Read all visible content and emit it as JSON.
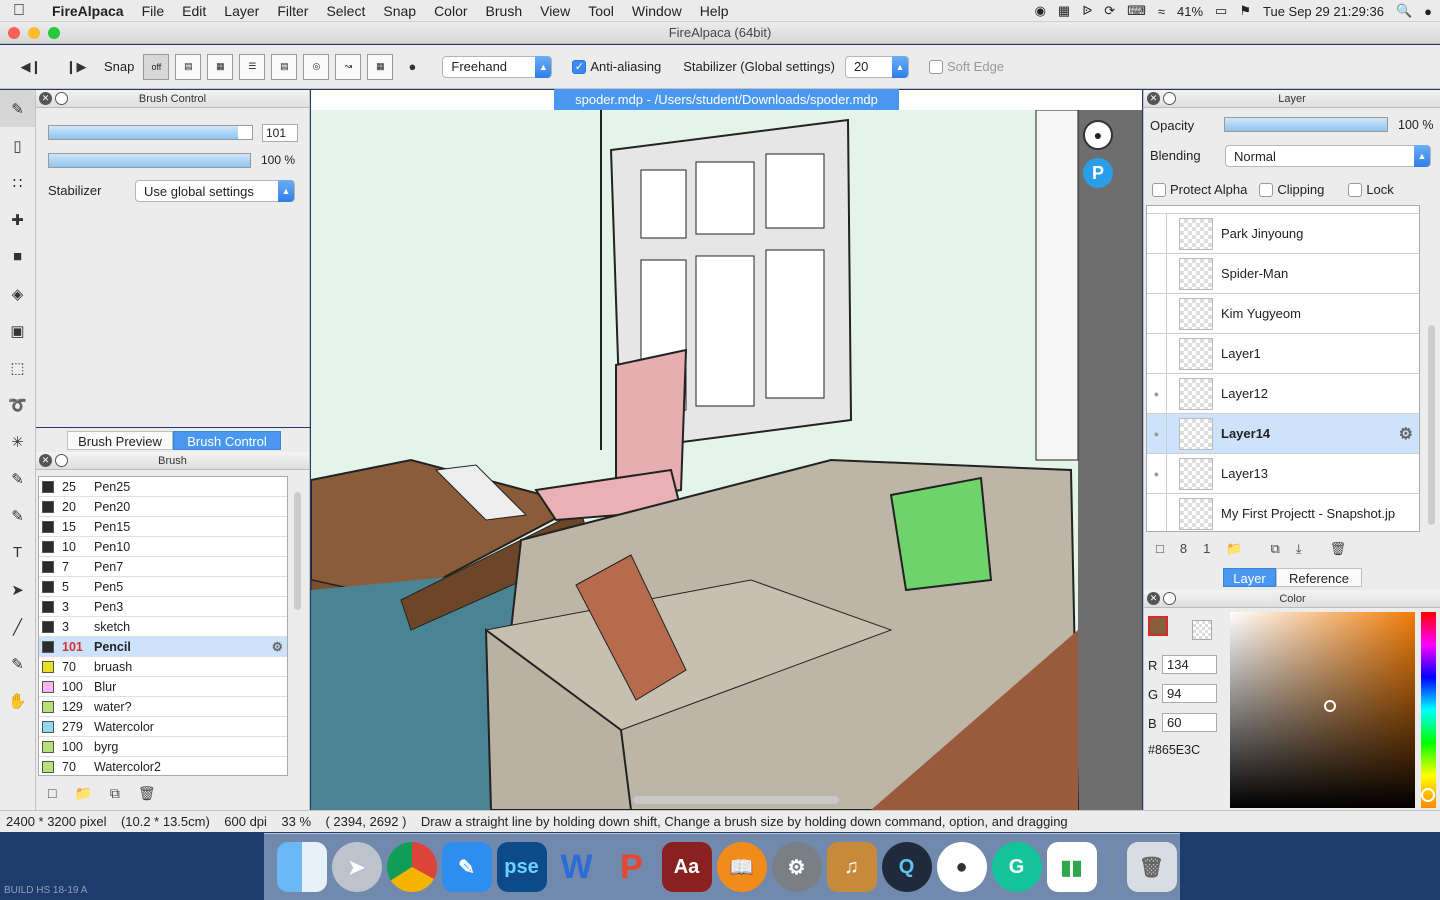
{
  "menubar": {
    "app": "FireAlpaca",
    "items": [
      "File",
      "Edit",
      "Layer",
      "Filter",
      "Select",
      "Snap",
      "Color",
      "Brush",
      "View",
      "Tool",
      "Window",
      "Help"
    ],
    "battery": "41%",
    "datetime": "Tue Sep 29  21:29:36"
  },
  "window": {
    "title": "FireAlpaca (64bit)"
  },
  "toolbar": {
    "snap_label": "Snap",
    "snap_off": "off",
    "mode_value": "Freehand",
    "antialias_label": "Anti-aliasing",
    "stabilizer_label": "Stabilizer (Global settings)",
    "stabilizer_value": "20",
    "softedge_label": "Soft Edge"
  },
  "brush_control": {
    "title": "Brush Control",
    "size_value": "101",
    "size_fill": 0.93,
    "opacity_value": "100 %",
    "opacity_fill": 1.0,
    "stabilizer_label": "Stabilizer",
    "stabilizer_value": "Use global settings"
  },
  "tabs_left": {
    "preview": "Brush Preview",
    "control": "Brush Control"
  },
  "brush_panel": {
    "title": "Brush",
    "items": [
      {
        "size": "25",
        "name": "Pen25",
        "color": "#2b2b2b"
      },
      {
        "size": "20",
        "name": "Pen20",
        "color": "#2b2b2b"
      },
      {
        "size": "15",
        "name": "Pen15",
        "color": "#2b2b2b"
      },
      {
        "size": "10",
        "name": "Pen10",
        "color": "#2b2b2b"
      },
      {
        "size": "7",
        "name": "Pen7",
        "color": "#2b2b2b"
      },
      {
        "size": "5",
        "name": "Pen5",
        "color": "#2b2b2b"
      },
      {
        "size": "3",
        "name": "Pen3",
        "color": "#2b2b2b"
      },
      {
        "size": "3",
        "name": "sketch",
        "color": "#2b2b2b"
      },
      {
        "size": "101",
        "name": "Pencil",
        "color": "#2b2b2b",
        "selected": true
      },
      {
        "size": "70",
        "name": "bruash",
        "color": "#e8e020"
      },
      {
        "size": "100",
        "name": "Blur",
        "color": "#f4b6f0"
      },
      {
        "size": "129",
        "name": "water?",
        "color": "#b8e07a"
      },
      {
        "size": "279",
        "name": "Watercolor",
        "color": "#8fd8f0"
      },
      {
        "size": "100",
        "name": "byrg",
        "color": "#b8e07a"
      },
      {
        "size": "70",
        "name": "Watercolor2",
        "color": "#b8e07a"
      }
    ]
  },
  "document": {
    "tab": "spoder.mdp - /Users/student/Downloads/spoder.mdp"
  },
  "layer_panel": {
    "title": "Layer",
    "opacity_label": "Opacity",
    "opacity_value": "100 %",
    "opacity_fill": 1.0,
    "blending_label": "Blending",
    "blending_value": "Normal",
    "protect_alpha": "Protect Alpha",
    "clipping": "Clipping",
    "lock": "Lock",
    "layers": [
      {
        "name": "Park Jinyoung"
      },
      {
        "name": "Spider-Man"
      },
      {
        "name": "Kim Yugyeom"
      },
      {
        "name": "Layer1"
      },
      {
        "name": "Layer12"
      },
      {
        "name": "Layer14",
        "selected": true
      },
      {
        "name": "Layer13"
      },
      {
        "name": "My First Projectt - Snapshot.jp"
      }
    ]
  },
  "tabs_right": {
    "layer": "Layer",
    "reference": "Reference"
  },
  "color_panel": {
    "title": "Color",
    "r_label": "R",
    "r": "134",
    "g_label": "G",
    "g": "94",
    "b_label": "B",
    "b": "60",
    "hex": "#865E3C"
  },
  "status": {
    "size": "2400 * 3200 pixel",
    "cm": "(10.2 * 13.5cm)",
    "dpi": "600 dpi",
    "zoom": "33 %",
    "coords": "( 2394, 2692 )",
    "hint": "Draw a straight line by holding down shift, Change a brush size by holding down command, option, and dragging"
  },
  "dock": {
    "apps": [
      "Finder",
      "Launchpad",
      "Chrome",
      "Pages",
      "pse",
      "Word",
      "PowerPoint",
      "Dictionary",
      "iBooks",
      "System Preferences",
      "GarageBand",
      "QuickTime",
      "FireAlpaca",
      "Grammarly",
      "Numbers",
      "Trash"
    ],
    "pse_label": "pse",
    "dict_label": "Aa"
  },
  "build": "BUILD HS 18-19 A"
}
